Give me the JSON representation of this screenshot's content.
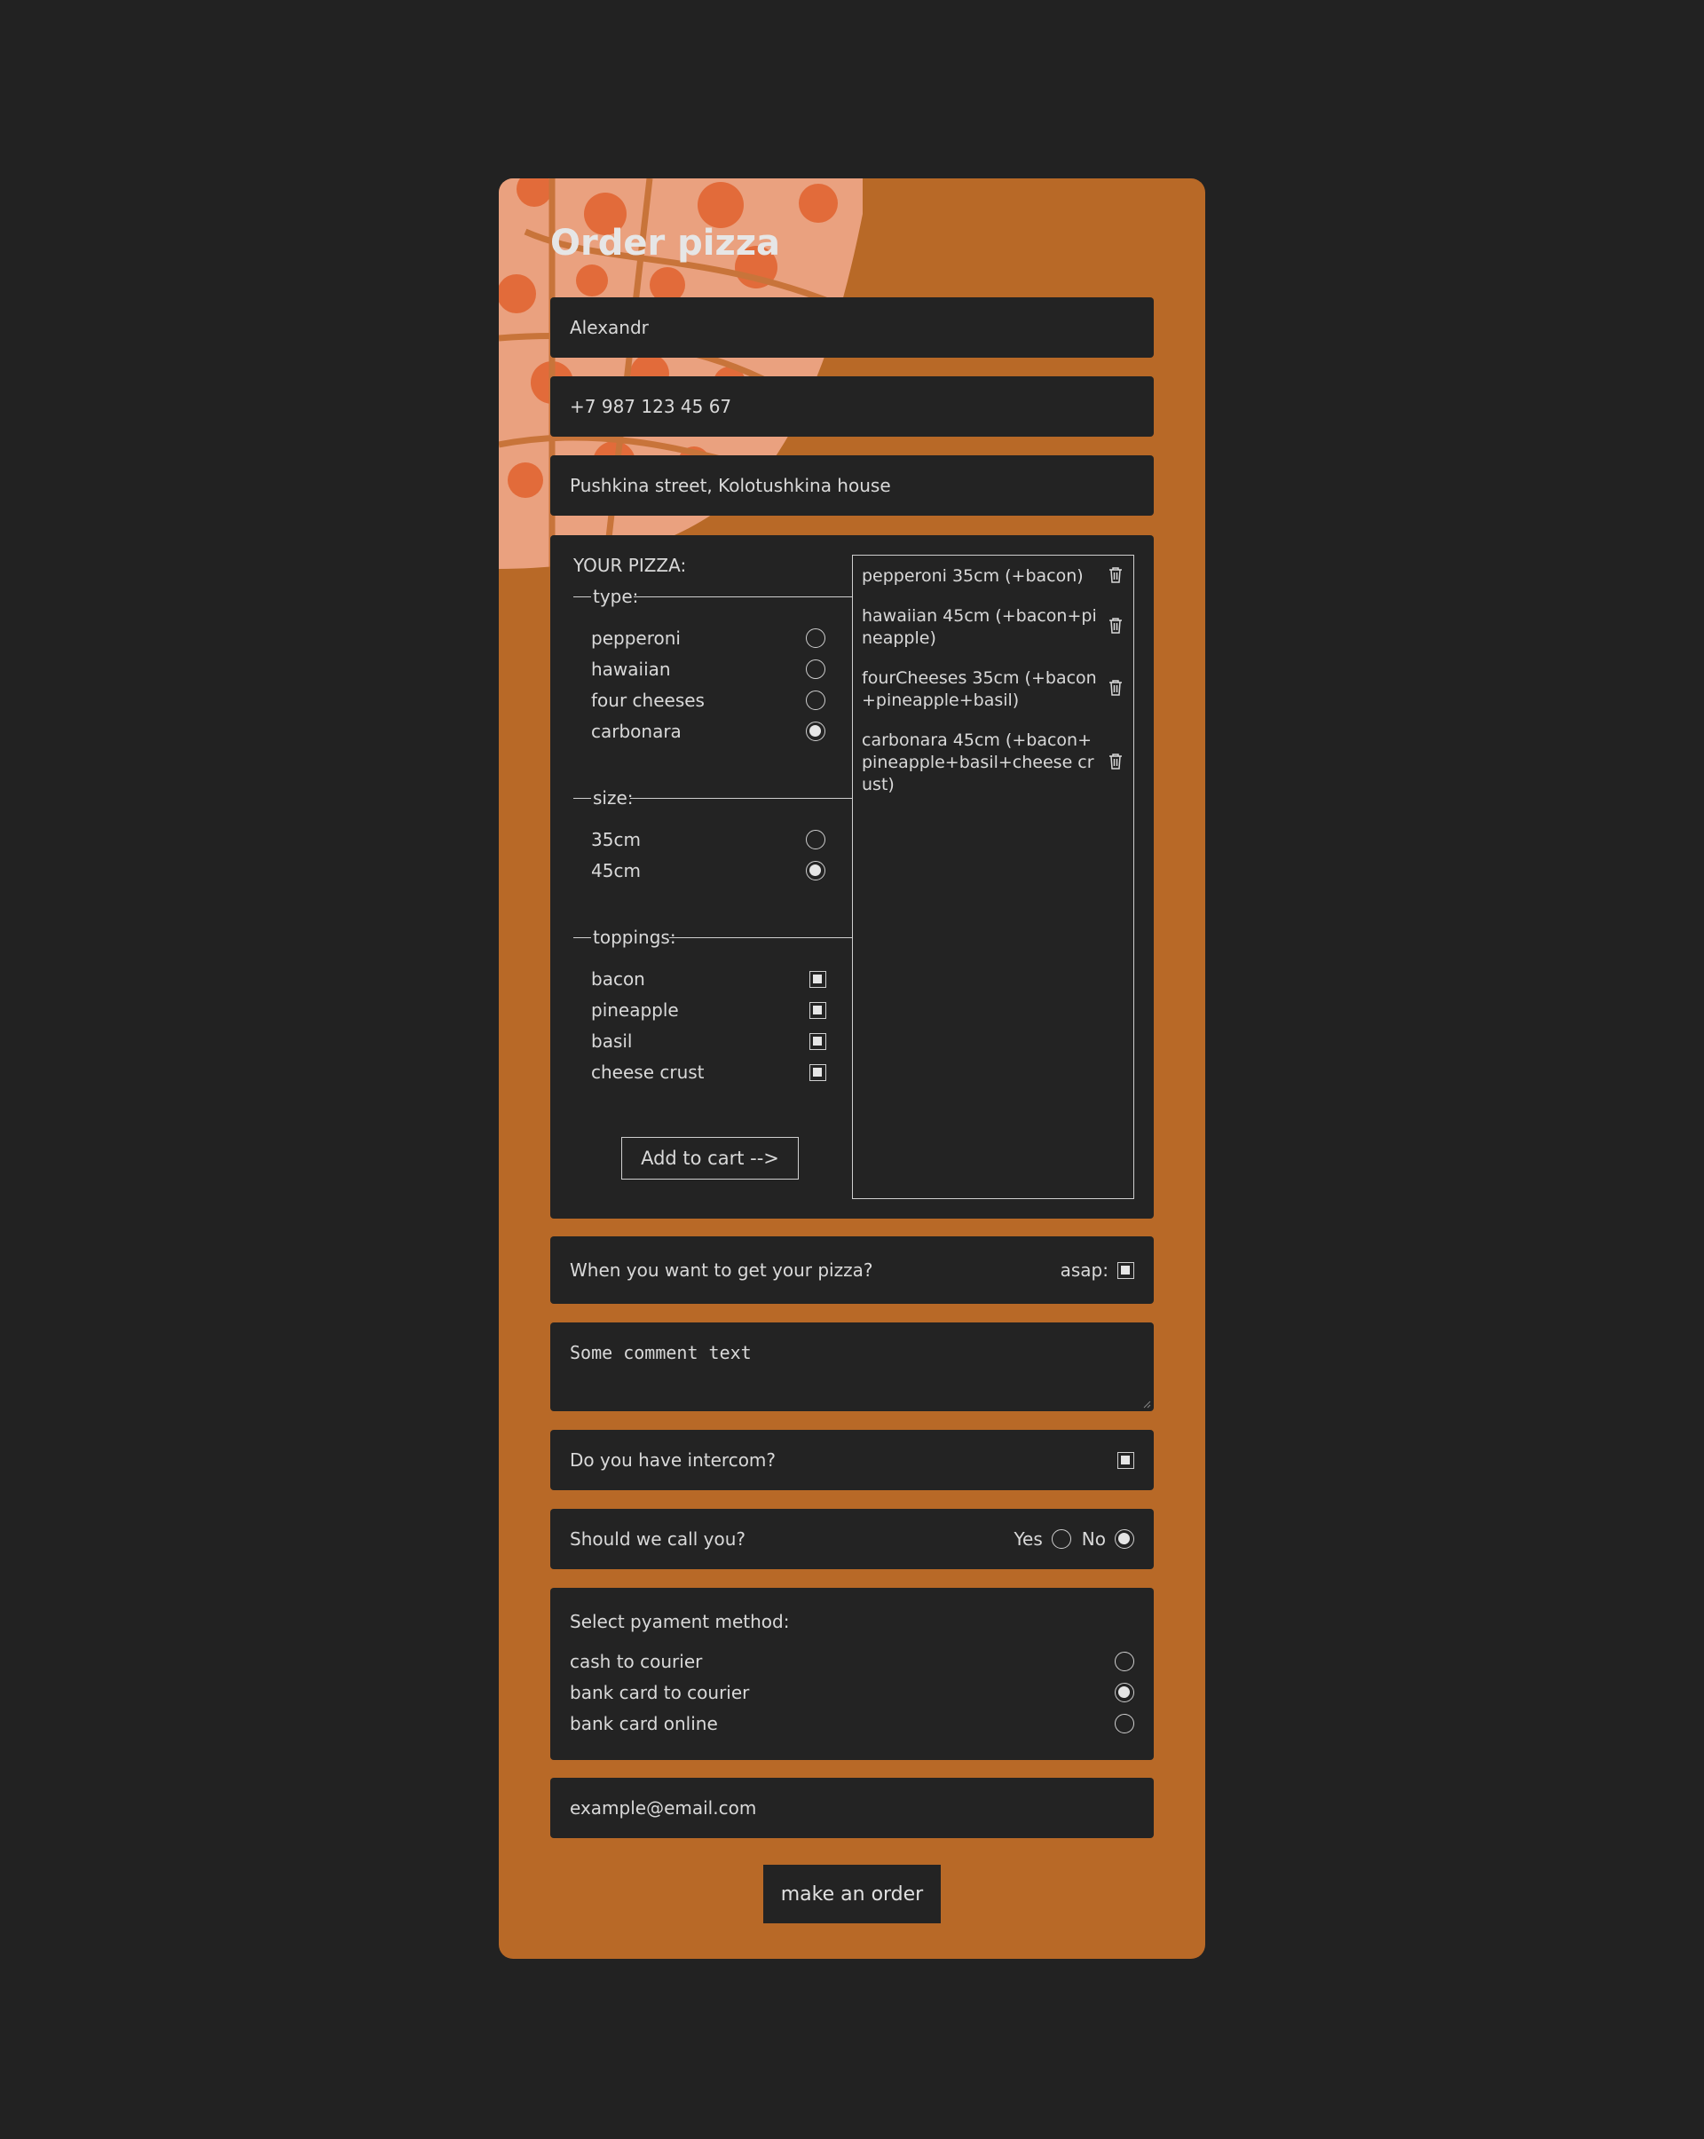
{
  "title": "Order pizza",
  "form": {
    "name": "Alexandr",
    "phone": "+7 987 123 45 67",
    "address": "Pushkina street, Kolotushkina house"
  },
  "pizza_builder": {
    "heading": "YOUR PIZZA:",
    "type": {
      "legend": "type:",
      "options": [
        "pepperoni",
        "hawaiian",
        "four cheeses",
        "carbonara"
      ],
      "selected": "carbonara"
    },
    "size": {
      "legend": "size:",
      "options": [
        "35cm",
        "45cm"
      ],
      "selected": "45cm"
    },
    "toppings": {
      "legend": "toppings:",
      "options": [
        "bacon",
        "pineapple",
        "basil",
        "cheese crust"
      ],
      "checked": [
        "bacon",
        "pineapple",
        "basil",
        "cheese crust"
      ]
    },
    "add_button": "Add to cart -->"
  },
  "cart": {
    "items": [
      "pepperoni 35cm (+bacon)",
      "hawaiian 45cm (+bacon+pineapple)",
      "fourCheeses 35cm (+bacon+pineapple+basil)",
      "carbonara 45cm (+bacon+pineapple+basil+cheese crust)"
    ],
    "delete_icon": "trash-icon"
  },
  "delivery_time": {
    "label": "When you want to get your pizza?",
    "asap_label": "asap:",
    "asap_checked": true
  },
  "comment": "Some comment text",
  "intercom": {
    "label": "Do you have intercom?",
    "checked": true
  },
  "call": {
    "label": "Should we call you?",
    "yes_label": "Yes",
    "no_label": "No",
    "selected": "No"
  },
  "payment": {
    "heading": "Select pyament method:",
    "options": [
      "cash to courier",
      "bank card to courier",
      "bank card online"
    ],
    "selected": "bank card to courier"
  },
  "email_placeholder": "example@email.com",
  "submit_label": "make an order",
  "colors": {
    "page_bg": "#222222",
    "card_bg": "#b86927",
    "field_bg": "#232323",
    "text": "#d9d9d9",
    "pizza_art": "#eaa17f"
  }
}
